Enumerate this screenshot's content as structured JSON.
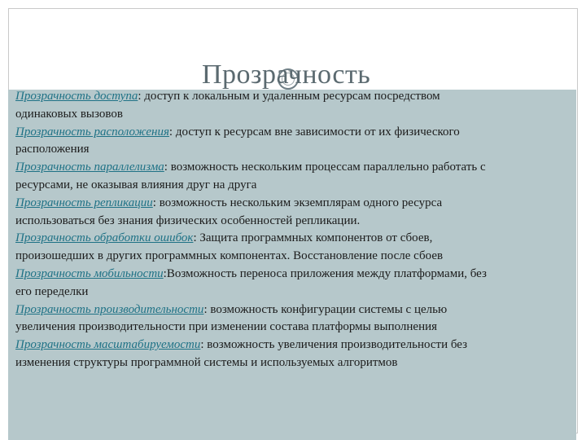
{
  "slide": {
    "title": "Прозрачность",
    "items": [
      {
        "term": "Прозрачность доступа",
        "text": ": доступ к локальным и удаленным ресурсам посредством одинаковых вызовов"
      },
      {
        "term": "Прозрачность расположения",
        "text": ": доступ к ресурсам вне зависимости от их физического расположения"
      },
      {
        "term": "Прозрачность параллелизма",
        "text": ": возможность нескольким процессам параллельно работать с ресурсами, не оказывая влияния друг на друга"
      },
      {
        "term": "Прозрачность репликации",
        "text": ": возможность нескольким экземплярам одного ресурса использоваться без знания физических особенностей репликации."
      },
      {
        "term": "Прозрачность обработки ошибок",
        "text": ": Защита программных компонентов от сбоев, произошедших в других программных компонентах. Восстановление после сбоев"
      },
      {
        "term": "Прозрачность мобильности",
        "text": ":Возможность переноса приложения между платформами, без его переделки"
      },
      {
        "term": "Прозрачность производительности",
        "text": ": возможность конфигурации системы с целью увеличения производительности при изменении состава платформы выполнения"
      },
      {
        "term": "Прозрачность масштабируемости",
        "text": ": возможность увеличения производительности без изменения структуры программной системы и используемых алгоритмов"
      }
    ]
  },
  "colors": {
    "panel_background": "#b6c8cb",
    "term_color": "#1f7286",
    "title_color": "#5b6a70"
  }
}
